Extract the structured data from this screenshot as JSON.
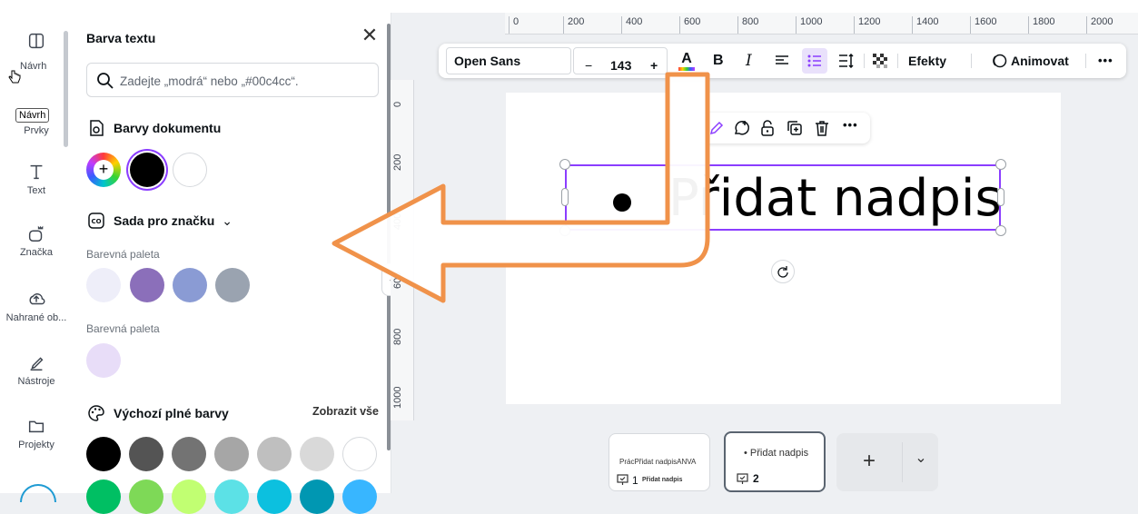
{
  "colors": {
    "accent": "#8b3dff",
    "arrow": "#f0924a"
  },
  "rail": {
    "items": [
      {
        "label": "Návrh",
        "icon": "layout-icon"
      },
      {
        "label": "Prvky",
        "icon": "shapes-icon"
      },
      {
        "label": "Text",
        "icon": "text-icon"
      },
      {
        "label": "Značka",
        "icon": "brand-icon"
      },
      {
        "label": "Nahrané ob...",
        "icon": "upload-cloud-icon"
      },
      {
        "label": "Nástroje",
        "icon": "pen-icon"
      },
      {
        "label": "Projekty",
        "icon": "folder-icon"
      }
    ],
    "tooltip": "Návrh"
  },
  "panel": {
    "title": "Barva textu",
    "search_placeholder": "Zadejte „modrá“ nebo „#00c4cc“.",
    "doc_colors_title": "Barvy dokumentu",
    "doc_colors": [
      "#000000",
      "#ffffff"
    ],
    "brand_title": "Sada pro značku",
    "palette_label_1": "Barevná paleta",
    "palette_1": [
      "#eeeef9",
      "#8b6fba",
      "#8a9bd4",
      "#9aa3b0"
    ],
    "palette_label_2": "Barevná paleta",
    "palette_2": [
      "#e8ddf8"
    ],
    "default_title": "Výchozí plné barvy",
    "show_all": "Zobrazit vše",
    "default_colors_row1": [
      "#000000",
      "#545454",
      "#737373",
      "#a6a6a6",
      "#bfbfbf",
      "#d9d9d9",
      "#ffffff"
    ],
    "default_colors_row2": [
      "#00bf63",
      "#7ed957",
      "#c1ff72",
      "#5ce1e6",
      "#0cc0df",
      "#0097b2",
      "#38b6ff"
    ]
  },
  "ruler": {
    "top_ticks": [
      "0",
      "200",
      "400",
      "600",
      "800",
      "1000",
      "1200",
      "1400",
      "1600",
      "1800",
      "2000"
    ],
    "left_ticks": [
      "0",
      "200",
      "400",
      "600",
      "800",
      "1000"
    ]
  },
  "toolbar": {
    "font": "Open Sans",
    "minus": "−",
    "size": "143",
    "plus": "+",
    "effects": "Efekty",
    "animate": "Animovat",
    "more": "•••"
  },
  "canvas": {
    "headline": "Přidat nadpis"
  },
  "pages": {
    "thumb1_line1": "PrácPřidat nadpisANVA",
    "thumb1_label": "Přidat nadpis",
    "thumb1_num": "1",
    "thumb2_text": "• Přidat nadpis",
    "thumb2_num": "2",
    "add": "+",
    "expand": "⌄"
  }
}
